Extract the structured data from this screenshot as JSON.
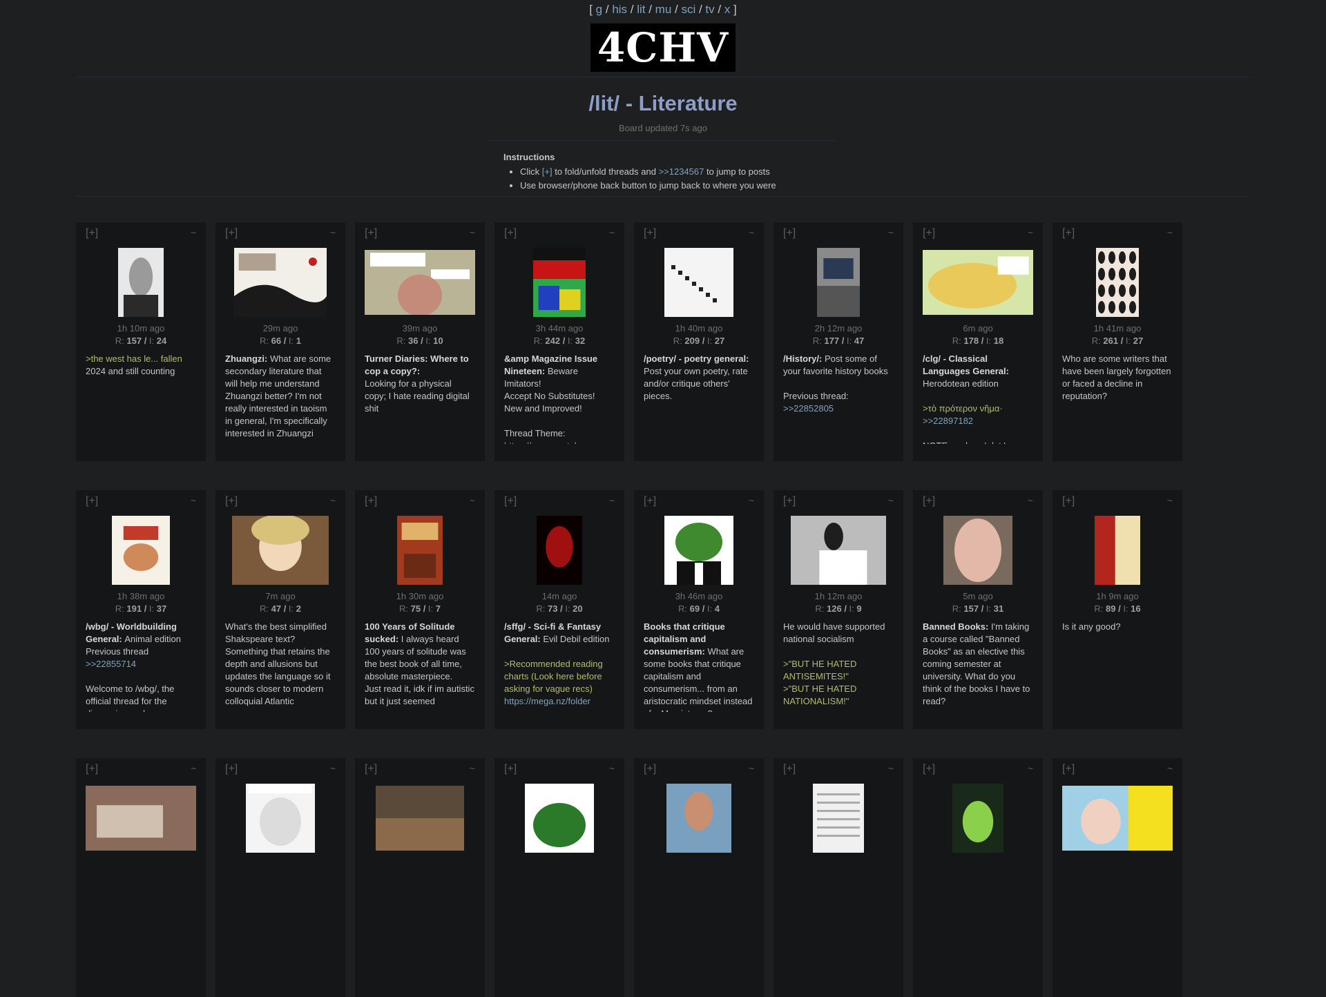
{
  "nav": {
    "boards": [
      "g",
      "his",
      "lit",
      "mu",
      "sci",
      "tv",
      "x"
    ],
    "open": "[",
    "close": "]",
    "sep": "/"
  },
  "logo": "4CHV",
  "board": {
    "title": "/lit/ - Literature",
    "updated": "Board updated 7s ago"
  },
  "instructions": {
    "heading": "Instructions",
    "line1_pre": "Click ",
    "line1_fold": "[+]",
    "line1_mid": " to fold/unfold threads and ",
    "line1_link": ">>1234567",
    "line1_post": " to jump to posts",
    "line2": "Use browser/phone back button to jump back to where you were"
  },
  "labels": {
    "fold": "[+]",
    "tilde": "~",
    "r": "R:",
    "i": "I:",
    "slash": "/"
  },
  "threads": [
    {
      "time": "1h 10m ago",
      "r": "157",
      "i": "24",
      "thumb": {
        "w": 66,
        "h": 100,
        "c1": "#e8e8e8",
        "c2": "#2a2a2a",
        "kind": "portrait"
      },
      "parts": [
        {
          "t": "quote",
          "v": ">the west has le... fallen"
        },
        {
          "t": "br"
        },
        {
          "t": "text",
          "v": "2024 and still counting"
        }
      ]
    },
    {
      "time": "29m ago",
      "r": "66",
      "i": "1",
      "thumb": {
        "w": 134,
        "h": 100,
        "c1": "#f2efe8",
        "c2": "#1a1a1a",
        "kind": "painting"
      },
      "parts": [
        {
          "t": "subj",
          "v": "Zhuangzi: "
        },
        {
          "t": "text",
          "v": "What are some secondary literature that will help me understand Zhuangzi better? I'm not really interested in taoism in general, I'm specifically interested in Zhuangzi"
        }
      ]
    },
    {
      "time": "39m ago",
      "r": "36",
      "i": "10",
      "thumb": {
        "w": 160,
        "h": 94,
        "c1": "#b9b495",
        "c2": "#c48a7a",
        "kind": "meme"
      },
      "parts": [
        {
          "t": "subj",
          "v": "Turner Diaries: Where to cop a copy?: "
        },
        {
          "t": "br"
        },
        {
          "t": "text",
          "v": "Looking for a physical copy; I hate reading digital shit"
        }
      ]
    },
    {
      "time": "3h 44m ago",
      "r": "242",
      "i": "32",
      "thumb": {
        "w": 76,
        "h": 100,
        "c1": "#c81414",
        "c2": "#2fa84a",
        "kind": "zine"
      },
      "parts": [
        {
          "t": "subj",
          "v": "&amp Magazine Issue Nineteen: "
        },
        {
          "t": "text",
          "v": "Beware Imitators!"
        },
        {
          "t": "br"
        },
        {
          "t": "text",
          "v": "Accept No Substitutes!"
        },
        {
          "t": "br"
        },
        {
          "t": "text",
          "v": "New and Improved!"
        },
        {
          "t": "br"
        },
        {
          "t": "br"
        },
        {
          "t": "text",
          "v": "Thread Theme:"
        },
        {
          "t": "br"
        },
        {
          "t": "link",
          "v": "https://www.youtube.com"
        }
      ]
    },
    {
      "time": "1h 40m ago",
      "r": "209",
      "i": "27",
      "thumb": {
        "w": 100,
        "h": 100,
        "c1": "#f4f4f4",
        "c2": "#222222",
        "kind": "poetry"
      },
      "parts": [
        {
          "t": "subj",
          "v": "/poetry/ - poetry general: "
        },
        {
          "t": "text",
          "v": "Post your own poetry, rate and/or critique others' pieces."
        }
      ]
    },
    {
      "time": "2h 12m ago",
      "r": "177",
      "i": "47",
      "thumb": {
        "w": 62,
        "h": 100,
        "c1": "#8a8a8a",
        "c2": "#2a3a55",
        "kind": "book"
      },
      "parts": [
        {
          "t": "subj",
          "v": "/History/: "
        },
        {
          "t": "text",
          "v": "Post some of your favorite history books"
        },
        {
          "t": "br"
        },
        {
          "t": "br"
        },
        {
          "t": "text",
          "v": "Previous thread:"
        },
        {
          "t": "br"
        },
        {
          "t": "ql",
          "v": ">>22852805"
        }
      ]
    },
    {
      "time": "6m ago",
      "r": "178",
      "i": "18",
      "thumb": {
        "w": 160,
        "h": 94,
        "c1": "#d6e6a8",
        "c2": "#e8c95a",
        "kind": "map"
      },
      "parts": [
        {
          "t": "subj",
          "v": "/clg/ - Classical Languages General: "
        },
        {
          "t": "text",
          "v": "Herodotean edition"
        },
        {
          "t": "br"
        },
        {
          "t": "br"
        },
        {
          "t": "quote",
          "v": ">τὸ πρότερον νῆμα·"
        },
        {
          "t": "br"
        },
        {
          "t": "ql",
          "v": ">>22897182"
        },
        {
          "t": "br"
        },
        {
          "t": "br"
        },
        {
          "t": "text",
          "v": "NOTE: replace ' dot '"
        }
      ]
    },
    {
      "time": "1h 41m ago",
      "r": "261",
      "i": "27",
      "thumb": {
        "w": 62,
        "h": 100,
        "c1": "#f0e6dc",
        "c2": "#1c1c1c",
        "kind": "silhouettes"
      },
      "parts": [
        {
          "t": "text",
          "v": "Who are some writers that have been largely forgotten or faced a decline in reputation?"
        }
      ]
    },
    {
      "time": "1h 38m ago",
      "r": "191",
      "i": "37",
      "thumb": {
        "w": 84,
        "h": 100,
        "c1": "#f5f1e6",
        "c2": "#c23a2a",
        "kind": "bunny"
      },
      "parts": [
        {
          "t": "subj",
          "v": "/wbg/ - Worldbuilding General: "
        },
        {
          "t": "text",
          "v": "Animal edition"
        },
        {
          "t": "br"
        },
        {
          "t": "text",
          "v": "Previous thread"
        },
        {
          "t": "br"
        },
        {
          "t": "ql",
          "v": ">>22855714"
        },
        {
          "t": "br"
        },
        {
          "t": "br"
        },
        {
          "t": "text",
          "v": "Welcome to /wbg/, the official thread for the discussion and"
        }
      ]
    },
    {
      "time": "7m ago",
      "r": "47",
      "i": "2",
      "thumb": {
        "w": 140,
        "h": 100,
        "c1": "#7a5a3a",
        "c2": "#d8c27a",
        "kind": "anime"
      },
      "parts": [
        {
          "t": "text",
          "v": "What's the best simplified Shakspeare text? Something that retains the depth and allusions but updates the language so it sounds closer to modern colloquial Atlantic"
        }
      ]
    },
    {
      "time": "1h 30m ago",
      "r": "75",
      "i": "7",
      "thumb": {
        "w": 66,
        "h": 100,
        "c1": "#a23a1e",
        "c2": "#e0b26a",
        "kind": "book2"
      },
      "parts": [
        {
          "t": "subj",
          "v": "100 Years of Solitude sucked: "
        },
        {
          "t": "text",
          "v": "I always heard 100 years of solitude was the best book of all time, absolute masterpiece."
        },
        {
          "t": "br"
        },
        {
          "t": "text",
          "v": "Just read it, idk if im autistic but it just seemed"
        }
      ]
    },
    {
      "time": "14m ago",
      "r": "73",
      "i": "20",
      "thumb": {
        "w": 66,
        "h": 100,
        "c1": "#0a0000",
        "c2": "#a01010",
        "kind": "dark"
      },
      "parts": [
        {
          "t": "subj",
          "v": "/sffg/ - Sci-fi & Fantasy General: "
        },
        {
          "t": "text",
          "v": "Evil Debil edition"
        },
        {
          "t": "br"
        },
        {
          "t": "br"
        },
        {
          "t": "quote",
          "v": ">Recommended reading charts (Look here before asking for vague recs)"
        },
        {
          "t": "br"
        },
        {
          "t": "link",
          "v": "https://mega.nz/folder"
        }
      ]
    },
    {
      "time": "3h 46m ago",
      "r": "69",
      "i": "4",
      "thumb": {
        "w": 100,
        "h": 100,
        "c1": "#ffffff",
        "c2": "#3f8a2e",
        "kind": "pepe"
      },
      "parts": [
        {
          "t": "subj",
          "v": "Books that critique capitalism and consumerism: "
        },
        {
          "t": "text",
          "v": "What are some books that critique capitalism and consumerism... from an aristocratic mindset instead of a Marxist one?"
        }
      ]
    },
    {
      "time": "1h 12m ago",
      "r": "126",
      "i": "9",
      "thumb": {
        "w": 138,
        "h": 100,
        "c1": "#d0d0d0",
        "c2": "#1e1e1e",
        "kind": "photo"
      },
      "parts": [
        {
          "t": "text",
          "v": "He would have supported national socialism"
        },
        {
          "t": "br"
        },
        {
          "t": "br"
        },
        {
          "t": "quote",
          "v": ">\"BUT HE HATED ANTISEMITES!\""
        },
        {
          "t": "br"
        },
        {
          "t": "quote",
          "v": ">\"BUT HE HATED NATIONALISM!\""
        }
      ]
    },
    {
      "time": "5m ago",
      "r": "157",
      "i": "31",
      "thumb": {
        "w": 100,
        "h": 100,
        "c1": "#7a6a5e",
        "c2": "#e2b8a8",
        "kind": "face"
      },
      "parts": [
        {
          "t": "subj",
          "v": "Banned Books: "
        },
        {
          "t": "text",
          "v": "I'm taking a course called \"Banned Books\" as an elective this coming semester at university. What do you think of the books I have to read?"
        }
      ]
    },
    {
      "time": "1h 9m ago",
      "r": "89",
      "i": "16",
      "thumb": {
        "w": 66,
        "h": 100,
        "c1": "#b3261e",
        "c2": "#f0e0b0",
        "kind": "iliad"
      },
      "parts": [
        {
          "t": "text",
          "v": "Is it any good?"
        }
      ]
    },
    {
      "time": "",
      "r": "",
      "i": "",
      "thumb": {
        "w": 160,
        "h": 94,
        "c1": "#8a6a5a",
        "c2": "#cfc0b0",
        "kind": "photo2"
      },
      "parts": []
    },
    {
      "time": "",
      "r": "",
      "i": "",
      "thumb": {
        "w": 100,
        "h": 100,
        "c1": "#f4f4f4",
        "c2": "#444444",
        "kind": "sketch"
      },
      "parts": []
    },
    {
      "time": "",
      "r": "",
      "i": "",
      "thumb": {
        "w": 128,
        "h": 94,
        "c1": "#5a4a3a",
        "c2": "#8a6a4a",
        "kind": "painting2"
      },
      "parts": []
    },
    {
      "time": "",
      "r": "",
      "i": "",
      "thumb": {
        "w": 100,
        "h": 100,
        "c1": "#ffffff",
        "c2": "#2a7a2a",
        "kind": "pepe2"
      },
      "parts": []
    },
    {
      "time": "",
      "r": "",
      "i": "",
      "thumb": {
        "w": 94,
        "h": 100,
        "c1": "#7aa0c0",
        "c2": "#c89070",
        "kind": "tattoo"
      },
      "parts": []
    },
    {
      "time": "",
      "r": "",
      "i": "",
      "thumb": {
        "w": 74,
        "h": 100,
        "c1": "#f0f0f0",
        "c2": "#222222",
        "kind": "text"
      },
      "parts": []
    },
    {
      "time": "",
      "r": "",
      "i": "",
      "thumb": {
        "w": 74,
        "h": 100,
        "c1": "#1a2a1a",
        "c2": "#8ad04a",
        "kind": "game"
      },
      "parts": []
    },
    {
      "time": "",
      "r": "",
      "i": "",
      "thumb": {
        "w": 160,
        "h": 94,
        "c1": "#9fd0e6",
        "c2": "#f5e020",
        "kind": "girl"
      },
      "parts": []
    }
  ]
}
